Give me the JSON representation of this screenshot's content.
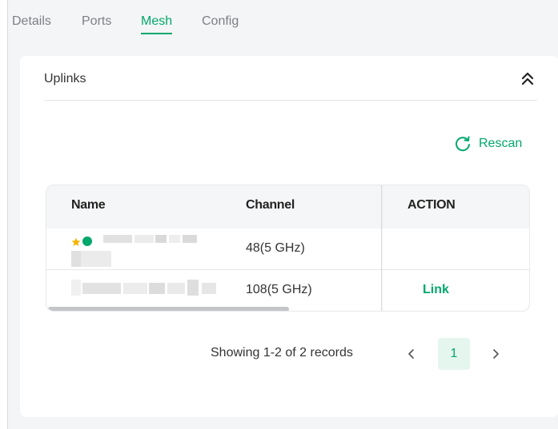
{
  "tabs": [
    {
      "label": "Details",
      "active": false
    },
    {
      "label": "Ports",
      "active": false
    },
    {
      "label": "Mesh",
      "active": true
    },
    {
      "label": "Config",
      "active": false
    }
  ],
  "uplinks": {
    "title": "Uplinks",
    "collapse_icon": "double-chevron-up-icon",
    "rescan_label": "Rescan",
    "rescan_icon": "refresh-icon",
    "columns": [
      "Name",
      "Channel",
      "ACTION"
    ],
    "rows": [
      {
        "name": "",
        "preferred": true,
        "status": "online",
        "channel": "48(5 GHz)",
        "action": ""
      },
      {
        "name": "",
        "preferred": false,
        "status": "",
        "channel": "108(5 GHz)",
        "action": "Link"
      }
    ]
  },
  "pagination": {
    "summary": "Showing 1-2 of 2 records",
    "current_page": "1",
    "prev_icon": "chevron-left-icon",
    "next_icon": "chevron-right-icon"
  },
  "colors": {
    "accent": "#00a86b",
    "star": "#f5b400",
    "page_bg": "#f4f5f6",
    "card_bg": "#ffffff"
  }
}
